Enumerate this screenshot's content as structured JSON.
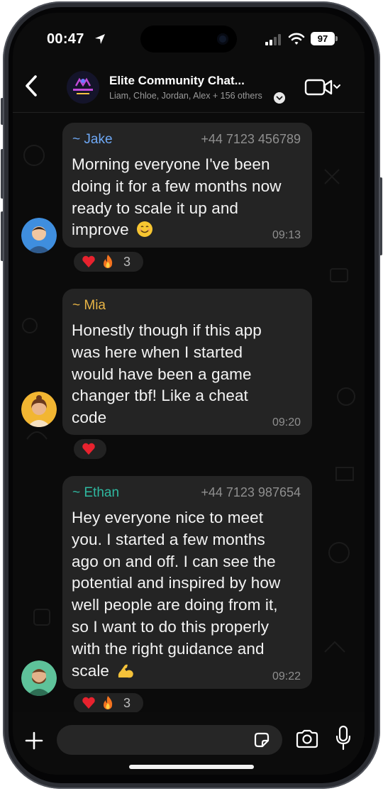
{
  "status_bar": {
    "time": "00:47",
    "battery": "97",
    "icons": [
      "location-arrow-icon",
      "signal-icon",
      "wifi-icon",
      "battery-icon"
    ]
  },
  "header": {
    "title": "Elite Community Chat...",
    "members": "Liam, Chloe, Jordan, Alex + 156 others",
    "avatar_text": "Tokkimetrics ELITE",
    "icons": [
      "back-chevron-icon",
      "chevron-down-icon",
      "video-camera-icon"
    ]
  },
  "messages": [
    {
      "sender": "~ Jake",
      "sender_color": "#6ea8f5",
      "phone": "+44 7123 456789",
      "lines": [
        "Morning everyone I've been",
        "doing it for a few months now",
        "ready to scale it up and",
        "improve"
      ],
      "emoji": "smiling-face-icon",
      "time": "09:13",
      "reactions": [
        "heart",
        "fire"
      ],
      "reaction_count": "3"
    },
    {
      "sender": "~ Mia",
      "sender_color": "#e9b546",
      "phone": "",
      "lines": [
        "Honestly though if this app",
        "was here when I started",
        "would have been a game",
        "changer tbf! Like a cheat",
        "code"
      ],
      "time": "09:20",
      "reactions": [
        "heart"
      ],
      "reaction_count": ""
    },
    {
      "sender": "~ Ethan",
      "sender_color": "#2fb8a0",
      "phone": "+44 7123 987654",
      "lines": [
        "Hey everyone nice to meet",
        "you. I started a few months",
        "ago on and off. I can see the",
        "potential and inspired by how",
        "well people are doing from it,",
        "so I want to do this properly",
        "with the right guidance and",
        "scale"
      ],
      "emoji": "flexed-biceps-icon",
      "time": "09:22",
      "reactions": [
        "heart",
        "fire"
      ],
      "reaction_count": "3"
    }
  ],
  "input": {
    "value": "",
    "icons": [
      "plus-icon",
      "sticker-icon",
      "camera-icon",
      "microphone-icon"
    ]
  },
  "colors": {
    "bubble": "#242424",
    "background": "#0b0b0b",
    "meta_text": "#8f8f8f"
  }
}
